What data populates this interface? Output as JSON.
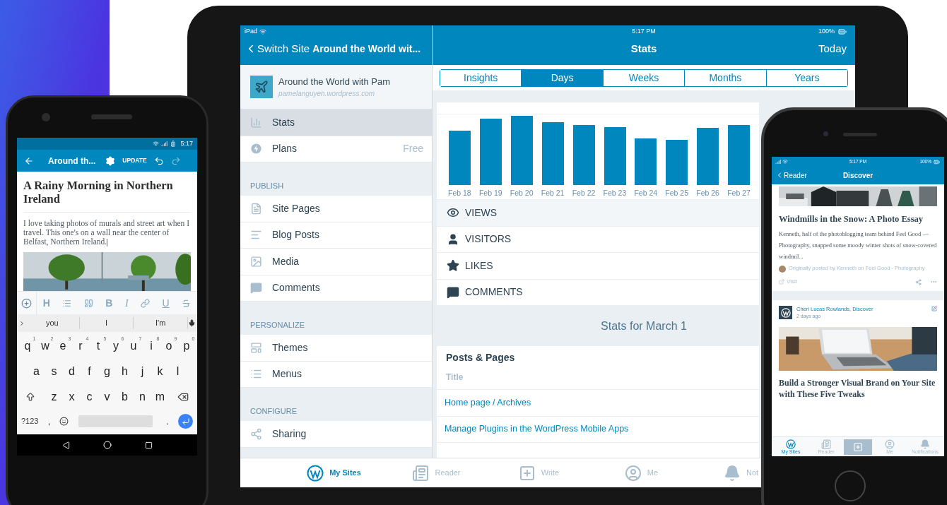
{
  "tablet": {
    "status": {
      "carrier": "iPad",
      "time": "5:17 PM",
      "battery": "100%"
    },
    "sidebar": {
      "back_label": "Switch Site",
      "header_title": "Around the World wit...",
      "site": {
        "name": "Around the World with Pam",
        "url": "pamelanguyen.wordpress.com"
      },
      "sections": [
        {
          "items": [
            {
              "label": "Stats",
              "selected": true
            },
            {
              "label": "Plans",
              "detail": "Free",
              "selected": false
            }
          ]
        },
        {
          "heading": "PUBLISH",
          "items": [
            {
              "label": "Site Pages",
              "selected": false
            },
            {
              "label": "Blog Posts",
              "selected": false
            },
            {
              "label": "Media",
              "selected": false
            },
            {
              "label": "Comments",
              "selected": false
            }
          ]
        },
        {
          "heading": "PERSONALIZE",
          "items": [
            {
              "label": "Themes",
              "selected": false
            },
            {
              "label": "Menus",
              "selected": false
            }
          ]
        },
        {
          "heading": "CONFIGURE",
          "items": [
            {
              "label": "Sharing",
              "selected": false
            }
          ]
        }
      ]
    },
    "main": {
      "title": "Stats",
      "action": "Today",
      "tabs": [
        {
          "label": "Insights",
          "selected": false
        },
        {
          "label": "Days",
          "selected": true
        },
        {
          "label": "Weeks",
          "selected": false
        },
        {
          "label": "Months",
          "selected": false
        },
        {
          "label": "Years",
          "selected": false
        }
      ],
      "chart": {
        "x_labels": [
          "Feb 18",
          "Feb 19",
          "Feb 20",
          "Feb 21",
          "Feb 22",
          "Feb 23",
          "Feb 24",
          "Feb 25",
          "Feb 26",
          "Feb 27"
        ]
      },
      "metrics": [
        {
          "label": "VIEWS",
          "selected": true
        },
        {
          "label": "VISITORS",
          "selected": false
        },
        {
          "label": "LIKES",
          "selected": false
        },
        {
          "label": "COMMENTS",
          "selected": false
        }
      ],
      "summary_title": "Stats for March 1",
      "posts_card": {
        "title": "Posts & Pages",
        "column": "Title",
        "rows": [
          "Home page / Archives",
          "Manage Plugins in the WordPress Mobile Apps"
        ]
      }
    },
    "tab_bar": [
      {
        "label": "My Sites",
        "selected": true
      },
      {
        "label": "Reader",
        "selected": false
      },
      {
        "label": "Write",
        "selected": false
      },
      {
        "label": "Me",
        "selected": false
      },
      {
        "label": "Not",
        "selected": false
      }
    ]
  },
  "phone_left": {
    "time": "5:17",
    "toolbar": {
      "title": "Around th...",
      "action": "UPDATE"
    },
    "post": {
      "title": "A Rainy Morning in Northern Ireland",
      "body": "I love taking photos of murals and street art when I travel. This one's on a wall near the center of Belfast, Northern Ireland."
    },
    "format_letters": {
      "heading": "H",
      "bold": "B",
      "italic": "I",
      "underline": "U"
    },
    "suggestions": [
      "you",
      "I",
      "I'm"
    ],
    "keyboard": {
      "rows": [
        [
          {
            "key": "q",
            "hint": "1"
          },
          {
            "key": "w",
            "hint": "2"
          },
          {
            "key": "e",
            "hint": "3"
          },
          {
            "key": "r",
            "hint": "4"
          },
          {
            "key": "t",
            "hint": "5"
          },
          {
            "key": "y",
            "hint": "6"
          },
          {
            "key": "u",
            "hint": "7"
          },
          {
            "key": "i",
            "hint": "8"
          },
          {
            "key": "o",
            "hint": "9"
          },
          {
            "key": "p",
            "hint": "0"
          }
        ],
        [
          {
            "key": "a"
          },
          {
            "key": "s"
          },
          {
            "key": "d"
          },
          {
            "key": "f"
          },
          {
            "key": "g"
          },
          {
            "key": "h"
          },
          {
            "key": "j"
          },
          {
            "key": "k"
          },
          {
            "key": "l"
          }
        ],
        [
          {
            "key": "z"
          },
          {
            "key": "x"
          },
          {
            "key": "c"
          },
          {
            "key": "v"
          },
          {
            "key": "b"
          },
          {
            "key": "n"
          },
          {
            "key": "m"
          }
        ]
      ],
      "symbols": "?123",
      "comma": ",",
      "period": "."
    }
  },
  "phone_right": {
    "status": {
      "time": "5:17 PM",
      "battery": "100%"
    },
    "back_label": "Reader",
    "title": "Discover",
    "post": {
      "title": "Windmills in the Snow: A Photo Essay",
      "excerpt": "Kenneth, half of the photoblogging team behind Feel Good — Photography, snapped some moody winter shots of snow-covered windmil...",
      "attribution": "Originally posted by Kenneth on Feel Good - Photography",
      "visit": "Visit"
    },
    "post_2": {
      "author": "Cheri Lucas Rowlands, Discover",
      "time": "2 days ago",
      "title": "Build a Stronger Visual Brand on Your Site with These Five Tweaks"
    },
    "tab_bar": [
      {
        "label": "My Sites",
        "selected": true
      },
      {
        "label": "Reader",
        "selected": false
      },
      {
        "label": "Me",
        "selected": false
      },
      {
        "label": "Notifications",
        "selected": false
      }
    ]
  }
}
